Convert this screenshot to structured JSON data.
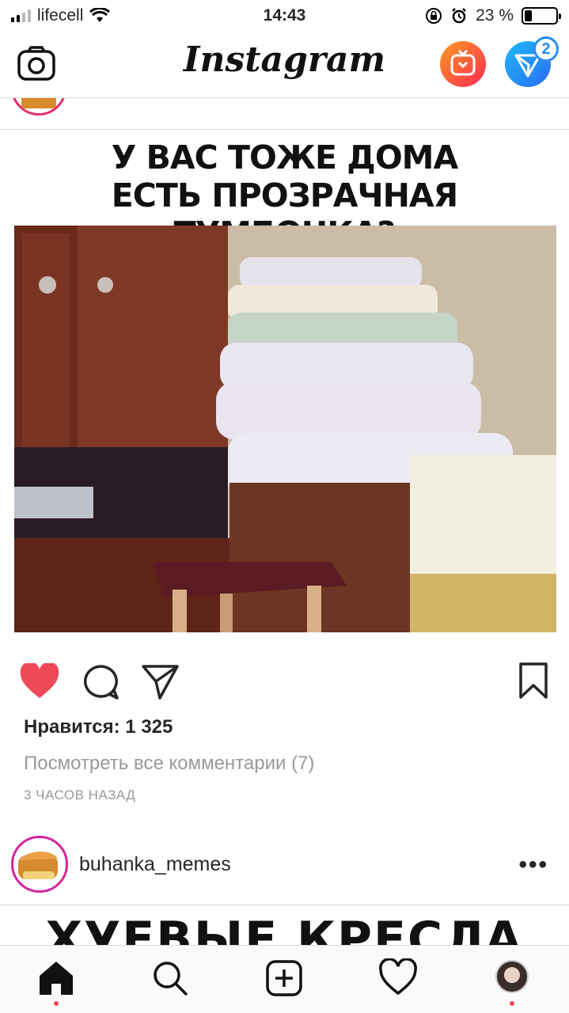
{
  "status_bar": {
    "carrier": "lifecell",
    "time": "14:43",
    "battery_label": "23 %",
    "battery_level": 0.23
  },
  "header": {
    "app_title": "Instagram",
    "direct_badge_count": "2",
    "icons": [
      "camera-icon",
      "igtv-icon",
      "direct-icon"
    ]
  },
  "post": {
    "image_caption_line1": "У ВАС ТОЖЕ ДОМА",
    "image_caption_line2": "ЕСТЬ ПРОЗРАЧНАЯ ТУМБОЧКА?",
    "liked": true,
    "likes_text": "Нравится: 1 325",
    "view_comments_text": "Посмотреть все комментарии (7)",
    "time_ago": "3 ЧАСОВ НАЗАД"
  },
  "next_post": {
    "username": "buhanka_memes",
    "more_label": "•••",
    "image_caption_partial": "ХУЕВЫЕ КРЕСЛА"
  },
  "tabbar": {
    "items": [
      "home",
      "search",
      "new-post",
      "activity",
      "profile"
    ],
    "accent_color": "#ed4956"
  },
  "colors": {
    "like_red": "#ed4956",
    "text": "#262626",
    "muted": "#999999",
    "divider": "#dbdbdb"
  }
}
